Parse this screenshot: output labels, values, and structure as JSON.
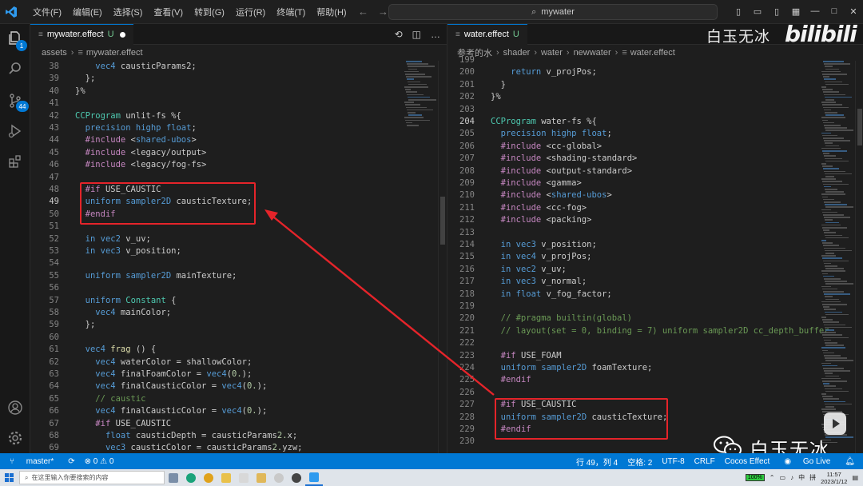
{
  "titlebar": {
    "menus": [
      "文件(F)",
      "编辑(E)",
      "选择(S)",
      "查看(V)",
      "转到(G)",
      "运行(R)",
      "终端(T)",
      "帮助(H)"
    ],
    "search_text": "mywater",
    "logo_icon": "vscode-logo-icon"
  },
  "activity": {
    "scm_badge": "44",
    "explorer_badge": "1"
  },
  "left_editor": {
    "tab_label": "mywater.effect",
    "tab_status": "U",
    "breadcrumb": [
      "assets",
      "mywater.effect"
    ],
    "lines": [
      {
        "n": "38",
        "t": "    vec4 causticParams2;"
      },
      {
        "n": "39",
        "t": "  };"
      },
      {
        "n": "40",
        "t": "}%"
      },
      {
        "n": "41",
        "t": ""
      },
      {
        "n": "42",
        "t": "CCProgram unlit-fs %{"
      },
      {
        "n": "43",
        "t": "  precision highp float;"
      },
      {
        "n": "44",
        "t": "  #include <shared-ubos>"
      },
      {
        "n": "45",
        "t": "  #include <legacy/output>"
      },
      {
        "n": "46",
        "t": "  #include <legacy/fog-fs>"
      },
      {
        "n": "47",
        "t": ""
      },
      {
        "n": "48",
        "t": "  #if USE_CAUSTIC"
      },
      {
        "n": "49",
        "t": "  uniform sampler2D causticTexture;"
      },
      {
        "n": "50",
        "t": "  #endif"
      },
      {
        "n": "51",
        "t": ""
      },
      {
        "n": "52",
        "t": "  in vec2 v_uv;"
      },
      {
        "n": "53",
        "t": "  in vec3 v_position;"
      },
      {
        "n": "54",
        "t": ""
      },
      {
        "n": "55",
        "t": "  uniform sampler2D mainTexture;"
      },
      {
        "n": "56",
        "t": ""
      },
      {
        "n": "57",
        "t": "  uniform Constant {"
      },
      {
        "n": "58",
        "t": "    vec4 mainColor;"
      },
      {
        "n": "59",
        "t": "  };"
      },
      {
        "n": "60",
        "t": ""
      },
      {
        "n": "61",
        "t": "  vec4 frag () {"
      },
      {
        "n": "62",
        "t": "    vec4 waterColor = shallowColor;"
      },
      {
        "n": "63",
        "t": "    vec4 finalFoamColor = vec4(0.);"
      },
      {
        "n": "64",
        "t": "    vec4 finalCausticColor = vec4(0.);"
      },
      {
        "n": "65",
        "t": "    // caustic"
      },
      {
        "n": "66",
        "t": "    vec4 finalCausticColor = vec4(0.);"
      },
      {
        "n": "67",
        "t": "    #if USE_CAUSTIC"
      },
      {
        "n": "68",
        "t": "      float causticDepth = causticParams2.x;"
      },
      {
        "n": "69",
        "t": "      vec3 causticColor = causticParams2.yzw;"
      }
    ]
  },
  "right_editor": {
    "tab_label": "water.effect",
    "tab_status": "U",
    "breadcrumb": [
      "参考的水",
      "shader",
      "water",
      "newwater",
      "water.effect"
    ],
    "lines": [
      {
        "n": "199",
        "t": ""
      },
      {
        "n": "200",
        "t": "    return v_projPos;"
      },
      {
        "n": "201",
        "t": "  }"
      },
      {
        "n": "202",
        "t": "}%"
      },
      {
        "n": "203",
        "t": ""
      },
      {
        "n": "204",
        "t": "CCProgram water-fs %{"
      },
      {
        "n": "205",
        "t": "  precision highp float;"
      },
      {
        "n": "206",
        "t": "  #include <cc-global>"
      },
      {
        "n": "207",
        "t": "  #include <shading-standard>"
      },
      {
        "n": "208",
        "t": "  #include <output-standard>"
      },
      {
        "n": "209",
        "t": "  #include <gamma>"
      },
      {
        "n": "210",
        "t": "  #include <shared-ubos>"
      },
      {
        "n": "211",
        "t": "  #include <cc-fog>"
      },
      {
        "n": "212",
        "t": "  #include <packing>"
      },
      {
        "n": "213",
        "t": ""
      },
      {
        "n": "214",
        "t": "  in vec3 v_position;"
      },
      {
        "n": "215",
        "t": "  in vec4 v_projPos;"
      },
      {
        "n": "216",
        "t": "  in vec2 v_uv;"
      },
      {
        "n": "217",
        "t": "  in vec3 v_normal;"
      },
      {
        "n": "218",
        "t": "  in float v_fog_factor;"
      },
      {
        "n": "219",
        "t": ""
      },
      {
        "n": "220",
        "t": "  // #pragma builtin(global)"
      },
      {
        "n": "221",
        "t": "  // layout(set = 0, binding = 7) uniform sampler2D cc_depth_buffer"
      },
      {
        "n": "222",
        "t": ""
      },
      {
        "n": "223",
        "t": "  #if USE_FOAM"
      },
      {
        "n": "224",
        "t": "  uniform sampler2D foamTexture;"
      },
      {
        "n": "225",
        "t": "  #endif"
      },
      {
        "n": "226",
        "t": ""
      },
      {
        "n": "227",
        "t": "  #if USE_CAUSTIC"
      },
      {
        "n": "228",
        "t": "  uniform sampler2D causticTexture;"
      },
      {
        "n": "229",
        "t": "  #endif"
      },
      {
        "n": "230",
        "t": ""
      }
    ]
  },
  "statusbar": {
    "branch": "master*",
    "problems": "⊗ 0 ⚠ 0",
    "position": "行 49，列 4",
    "spaces": "空格: 2",
    "encoding": "UTF-8",
    "eol": "CRLF",
    "language": "Cocos Effect",
    "golive": "Go Live"
  },
  "taskbar": {
    "search_placeholder": "在这里输入你要搜索的内容",
    "battery": "100%",
    "ime": "中",
    "time": "11:57",
    "date": "2023/1/12"
  },
  "watermark": {
    "top_text": "白玉无冰",
    "bili_text": "bilibili",
    "bottom_text": "白玉无冰"
  },
  "colors": {
    "accent": "#0078d4",
    "annotation": "#e5242a"
  }
}
